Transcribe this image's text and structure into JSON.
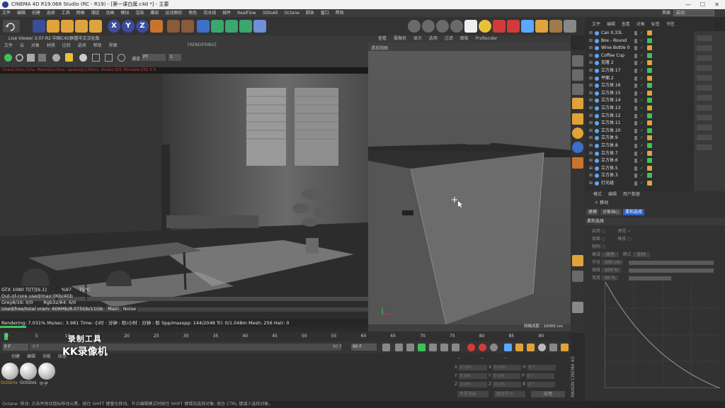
{
  "window": {
    "title": "CINEMA 4D R19.068 Studio (RC - R19) - [第一课白膜.c4d *] - 主要"
  },
  "menubar": {
    "items": [
      "文件",
      "编辑",
      "创建",
      "选择",
      "工具",
      "网格",
      "捕捉",
      "动画",
      "模拟",
      "渲染",
      "雕刻",
      "运动图形",
      "角色",
      "流水线",
      "插件",
      "RealFlow",
      "3DtoAll",
      "Octane",
      "脚本",
      "窗口",
      "帮助"
    ],
    "layout_label": "界面",
    "layout_value": "启动"
  },
  "toolbar": {
    "axis_x": "X",
    "axis_y": "Y",
    "axis_z": "Z"
  },
  "live_viewer": {
    "title": "Live Viewer 3.07-R2 中国C4D联盟中文汉化版",
    "menu": [
      "文件",
      "云",
      "对象",
      "材质",
      "比较",
      "选项",
      "帮助",
      "界面"
    ],
    "render_tag": "[RENDERING]",
    "channel_label": "通道",
    "channel_value": "PT",
    "status_line": "Check:0ms./1ms. MeshGen:0ms. Update[L]:90ms. Nodes:331 Movable:255  0 0",
    "info": {
      "gpu": "GTX 1080 Ti[T][6.1]",
      "gpu_load": "%97",
      "gpu_temp": "71°C",
      "out_of_core": "Out-of-core used/max:0Kb/4Gb",
      "grey": "Grey8/16: 0/0",
      "rgb": "Rgb32/64: 6/0",
      "vram": "Used/free/total vram: 606Mb/8.075Gb/11Gb",
      "tab_main": "Main",
      "tab_noise": "Noise"
    },
    "footer": "Rendering: 7.031% Ms/sec: 3.981   Time: 小时 : 分钟 : 秒/小时 : 分钟 : 秒   Spp/maxspp: 144/2048   Tri: 0/1.048m  Mesh: 256  Hair: 0",
    "progress_pct": 7.031
  },
  "viewport": {
    "menu": [
      "查看",
      "摄像机",
      "显示",
      "选项",
      "过滤",
      "面板",
      "ProRender"
    ],
    "label": "透视视图",
    "grid_label": "网格间距 : 10000 cm"
  },
  "timeline": {
    "ticks": [
      "0",
      "5",
      "10",
      "15",
      "20",
      "25",
      "30",
      "35",
      "40",
      "45",
      "50",
      "55",
      "60",
      "65",
      "70",
      "75",
      "80",
      "85",
      "90"
    ],
    "start_field": "0 F",
    "start_field2": "0 F",
    "end_field": "90 F",
    "end_field2": "90 F",
    "current_frame": "0 F"
  },
  "materials": {
    "menu": [
      "创建",
      "编辑",
      "功能",
      "纹理"
    ],
    "items": [
      {
        "label": "OctUniv"
      },
      {
        "label": "OctGlos"
      },
      {
        "label": "叶子"
      }
    ]
  },
  "coords": {
    "header": [
      "--",
      "--",
      "--"
    ],
    "rows": [
      {
        "a": "X",
        "av": "0 cm",
        "b": "X",
        "bv": "0 cm",
        "c": "H",
        "cv": "0 °"
      },
      {
        "a": "Y",
        "av": "0 cm",
        "b": "Y",
        "bv": "0 cm",
        "c": "P",
        "cv": "0 °"
      },
      {
        "a": "Z",
        "av": "0 cm",
        "b": "Z",
        "bv": "0 cm",
        "c": "B",
        "cv": "0 °"
      }
    ],
    "mode_left": "世界坐标",
    "mode_mid": "绝对尺寸",
    "apply": "应用"
  },
  "branding": "MAXON CINEMA 4D",
  "object_manager": {
    "menu": [
      "文件",
      "编辑",
      "查看",
      "对象",
      "标签",
      "书签"
    ],
    "objects": [
      "Can 0.33L",
      "Box - Round",
      "Wine Bottle 0",
      "Coffee Cup",
      "克隆 2",
      "立方体.17",
      "平面.2",
      "立方体.16",
      "立方体.15",
      "立方体.14",
      "立方体.13",
      "立方体.12",
      "立方体.11",
      "立方体.10",
      "立方体.9",
      "立方体.8",
      "立方体.7",
      "立方体.6",
      "立方体.5",
      "立方体.3",
      "灯光组"
    ]
  },
  "attributes": {
    "menu": [
      "模式",
      "编辑",
      "用户数据"
    ],
    "mode": "移动",
    "tabs": [
      {
        "label": "建模",
        "active": false
      },
      {
        "label": "对象轴心",
        "active": false
      },
      {
        "label": "柔和选择",
        "active": true
      }
    ],
    "section": "柔和选择",
    "rows": [
      {
        "label": "启用",
        "value": "预览 ✓"
      },
      {
        "label": "表面",
        "value": "橡皮"
      },
      {
        "label": "限制",
        "value": ""
      },
      {
        "label": "衰减",
        "value": "线性"
      },
      {
        "label": "模式",
        "value": "实时"
      },
      {
        "label": "半径",
        "value": "100 cm"
      },
      {
        "label": "强度",
        "value": "100 %"
      },
      {
        "label": "宽度",
        "value": "50 %"
      }
    ]
  },
  "watermark": {
    "line1": "录制工具",
    "line2": "KK录像机"
  },
  "status": "Octane: 移动: 点击并拖动鼠标移动元素。按住 SHIFT 键量化移动。节点编辑模式时按住 SHIFT 键增加选择对象; 按住 CTRL 键减少选择对象。"
}
